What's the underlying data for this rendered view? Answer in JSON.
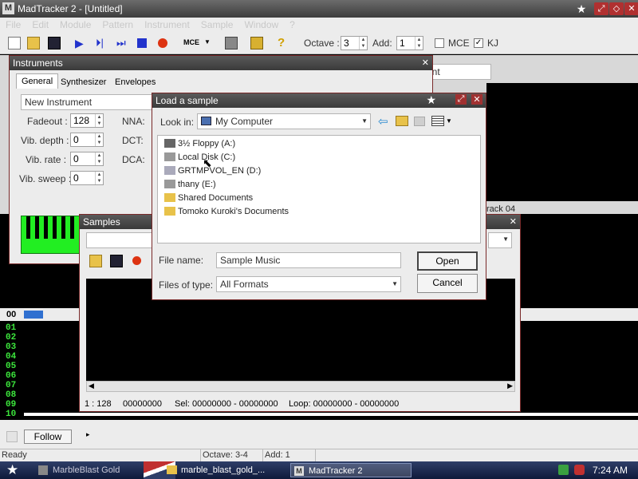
{
  "app": {
    "title": "MadTracker 2 - [Untitled]"
  },
  "menu": [
    "File",
    "Edit",
    "Module",
    "Pattern",
    "Instrument",
    "Sample",
    "Window",
    "?"
  ],
  "toolbar": {
    "mce_label": "MCE",
    "octave_label": "Octave :",
    "octave_value": "3",
    "add_label": "Add:",
    "add_value": "1",
    "mce_check": "MCE",
    "kj_check": "KJ"
  },
  "instruments": {
    "title": "Instruments",
    "tabs": [
      "General",
      "Synthesizer",
      "Envelopes"
    ],
    "name_value": "New Instrument",
    "fadeout_label": "Fadeout :",
    "fadeout_value": "128",
    "vib_depth_label": "Vib. depth :",
    "vib_depth_value": "0",
    "vib_rate_label": "Vib. rate :",
    "vib_rate_value": "0",
    "vib_sweep_label": "Vib. sweep :",
    "vib_sweep_value": "0",
    "nna_label": "NNA:",
    "dct_label": "DCT:",
    "dca_label": "DCA:"
  },
  "background": {
    "ment_text": "ment",
    "track_label": "rack 04"
  },
  "samples": {
    "title": "Samples",
    "status_pos": "1 : 128",
    "status_len": "00000000",
    "status_sel": "Sel: 00000000 - 00000000",
    "status_loop": "Loop: 00000000 - 00000000"
  },
  "dialog": {
    "title": "Load a sample",
    "look_in_label": "Look in:",
    "look_in_value": "My Computer",
    "items": [
      {
        "label": "3½ Floppy (A:)"
      },
      {
        "label": "Local Disk (C:)"
      },
      {
        "label": "GRTMPVOL_EN (D:)"
      },
      {
        "label": "thany (E:)"
      },
      {
        "label": "Shared Documents"
      },
      {
        "label": "Tomoko Kuroki's Documents"
      }
    ],
    "file_name_label": "File name:",
    "file_name_value": "Sample Music",
    "files_of_type_label": "Files of type:",
    "files_of_type_value": "All Formats",
    "open_button": "Open",
    "cancel_button": "Cancel"
  },
  "pattern": {
    "header": "00",
    "rows": [
      "01",
      "02",
      "03",
      "04",
      "05",
      "06",
      "07",
      "08",
      "09",
      "10"
    ]
  },
  "bottom": {
    "follow_label": "Follow"
  },
  "statusbar": {
    "ready": "Ready",
    "octave": "Octave: 3-4",
    "add": "Add: 1"
  },
  "taskbar": {
    "tasks": [
      "MarbleBlast Gold",
      "marble_blast_gold_...",
      "MadTracker 2"
    ],
    "clock": "7:24 AM"
  }
}
